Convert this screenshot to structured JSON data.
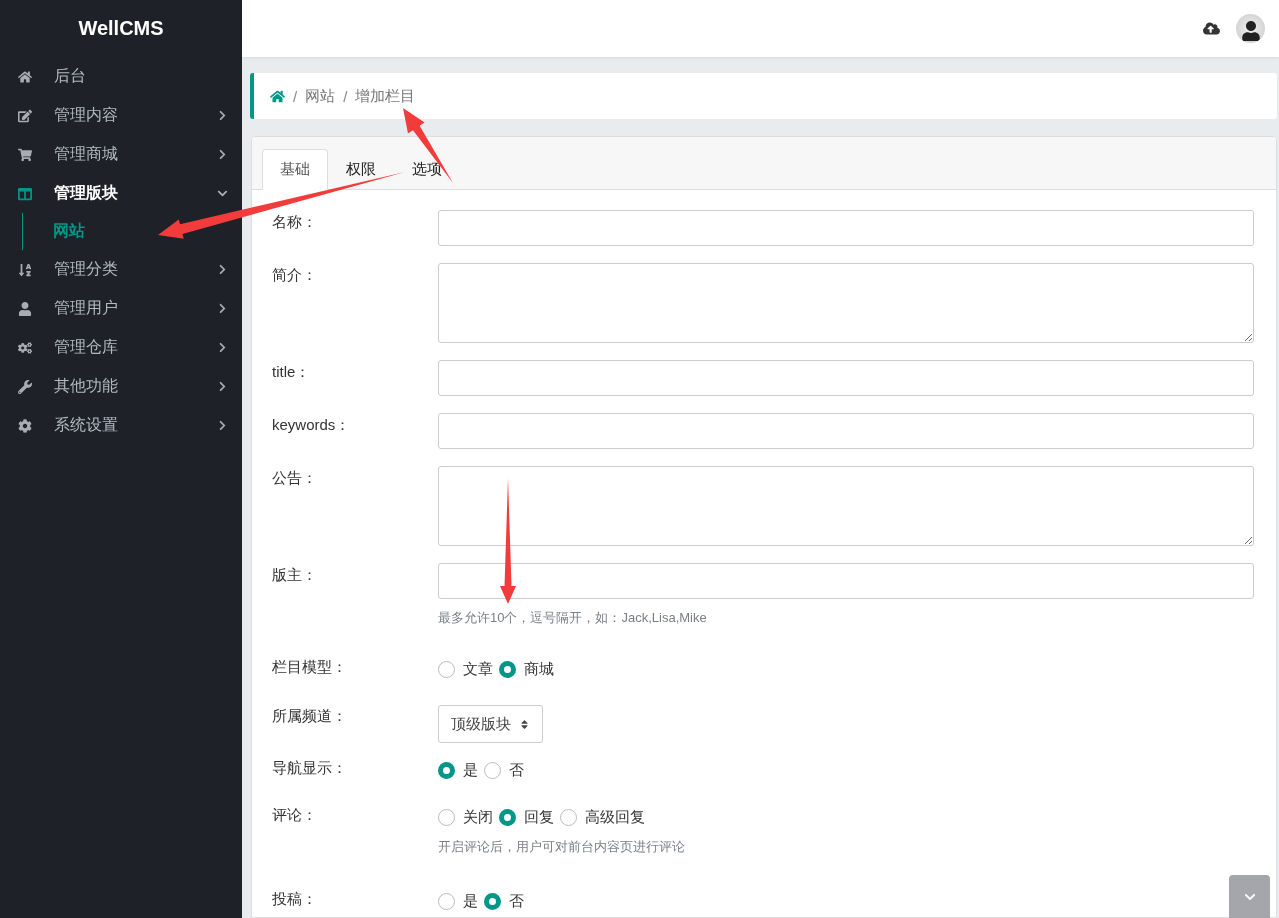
{
  "sidebar": {
    "brand": "WellCMS",
    "items": [
      {
        "label": "后台",
        "kind": "link",
        "selected": false
      },
      {
        "label": "管理内容",
        "kind": "menu",
        "selected": false,
        "expanded": false
      },
      {
        "label": "管理商城",
        "kind": "menu",
        "selected": false,
        "expanded": false
      },
      {
        "label": "管理版块",
        "kind": "menu",
        "selected": true,
        "expanded": true,
        "children": [
          {
            "label": "网站",
            "selected": true
          }
        ]
      },
      {
        "label": "管理分类",
        "kind": "menu",
        "selected": false,
        "expanded": false
      },
      {
        "label": "管理用户",
        "kind": "menu",
        "selected": false,
        "expanded": false
      },
      {
        "label": "管理仓库",
        "kind": "menu",
        "selected": false,
        "expanded": false
      },
      {
        "label": "其他功能",
        "kind": "menu",
        "selected": false,
        "expanded": false
      },
      {
        "label": "系统设置",
        "kind": "menu",
        "selected": false,
        "expanded": false
      }
    ]
  },
  "breadcrumb": [
    {
      "kind": "separator",
      "text": "/"
    },
    {
      "kind": "link",
      "text": "网站"
    },
    {
      "kind": "separator",
      "text": "/"
    },
    {
      "kind": "current",
      "text": "增加栏目"
    }
  ],
  "tabs": [
    {
      "label": "基础",
      "selected": true
    },
    {
      "label": "权限",
      "selected": false
    },
    {
      "label": "选项",
      "selected": false
    }
  ],
  "form": [
    {
      "kind": "input",
      "label": "名称："
    },
    {
      "kind": "textarea",
      "label": "简介："
    },
    {
      "kind": "input",
      "label": "title："
    },
    {
      "kind": "input",
      "label": "keywords："
    },
    {
      "kind": "textarea",
      "label": "公告："
    },
    {
      "kind": "input",
      "label": "版主：",
      "hint": "最多允许10个，逗号隔开，如：Jack,Lisa,Mike"
    },
    {
      "kind": "radio",
      "label": "栏目模型：",
      "options": [
        {
          "label": "文章",
          "selected": false
        },
        {
          "label": "商城",
          "selected": true
        }
      ]
    },
    {
      "kind": "select",
      "label": "所属频道：",
      "value": "顶级版块"
    },
    {
      "kind": "radio",
      "label": "导航显示：",
      "options": [
        {
          "label": "是",
          "selected": true
        },
        {
          "label": "否",
          "selected": false
        }
      ]
    },
    {
      "kind": "radio",
      "label": "评论：",
      "options": [
        {
          "label": "关闭",
          "selected": false
        },
        {
          "label": "回复",
          "selected": true
        },
        {
          "label": "高级回复",
          "selected": false
        }
      ],
      "hint": "开启评论后，用户可对前台内容页进行评论"
    },
    {
      "kind": "radio",
      "label": "投稿：",
      "options": [
        {
          "label": "是",
          "selected": false
        },
        {
          "label": "否",
          "selected": true
        }
      ]
    }
  ]
}
